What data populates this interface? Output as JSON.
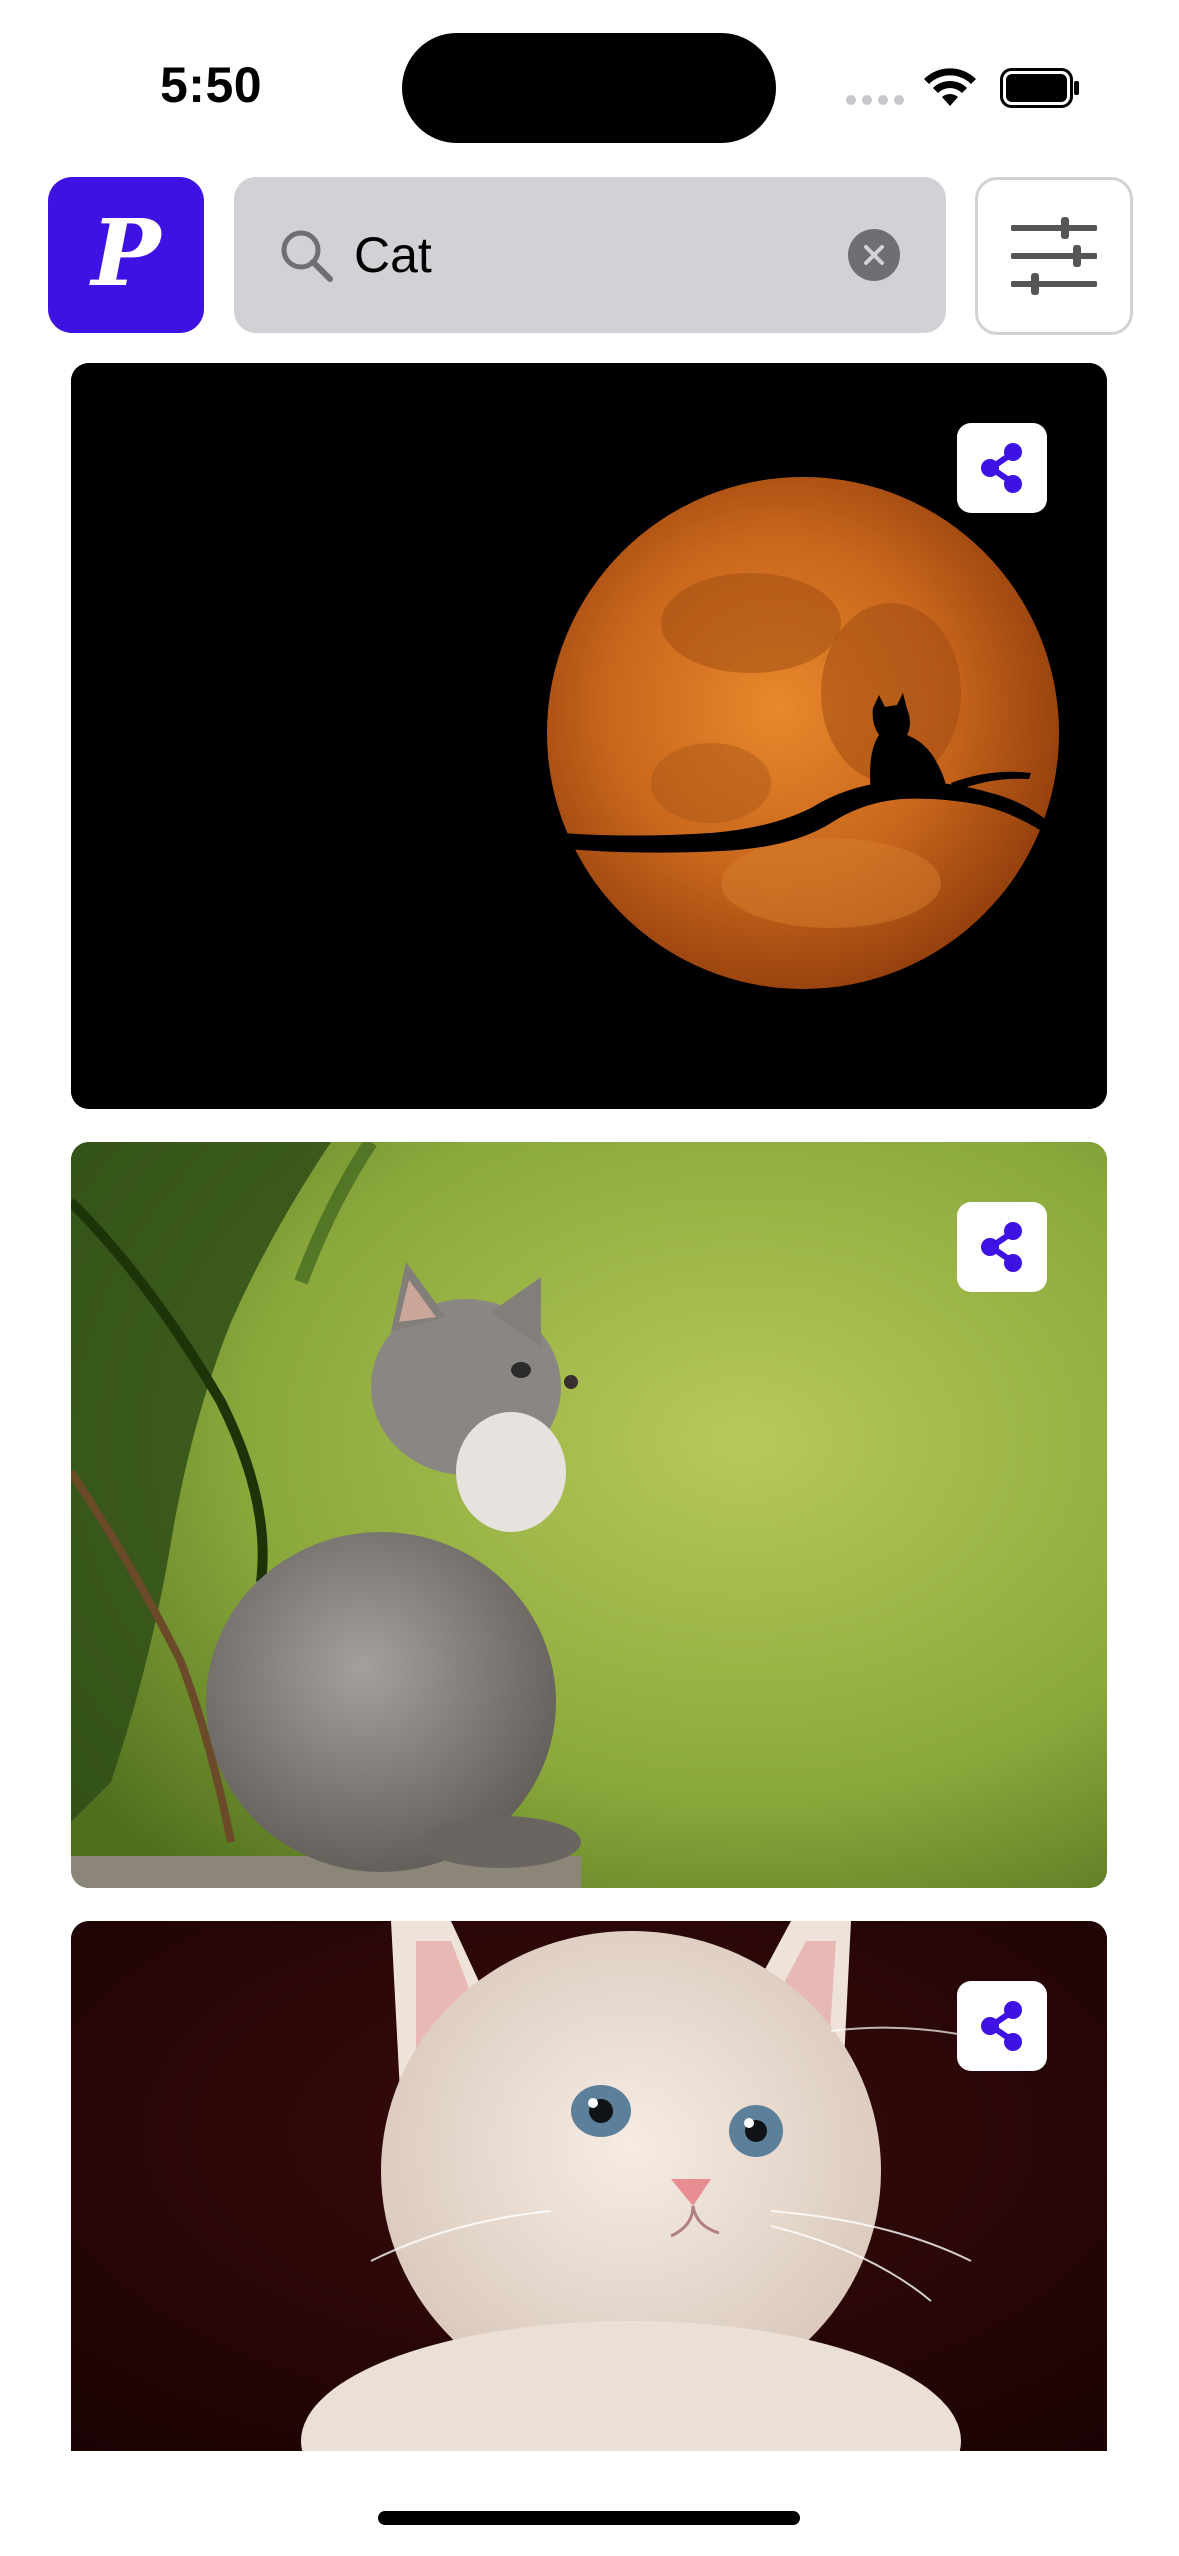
{
  "status_bar": {
    "time": "5:50",
    "icons": [
      "cellular-signal-icon",
      "wifi-icon",
      "battery-icon"
    ]
  },
  "header": {
    "logo_letter": "P",
    "logo_color": "#3d12e3",
    "search": {
      "value": "Cat",
      "icon": "search-icon",
      "clear_icon": "clear-icon"
    },
    "filter_icon": "sliders-icon"
  },
  "results": [
    {
      "description_icon": "share-icon"
    },
    {
      "description_icon": "share-icon"
    },
    {
      "description_icon": "share-icon"
    }
  ],
  "colors": {
    "accent": "#3d12e3",
    "search_background": "#d1d1d6"
  }
}
